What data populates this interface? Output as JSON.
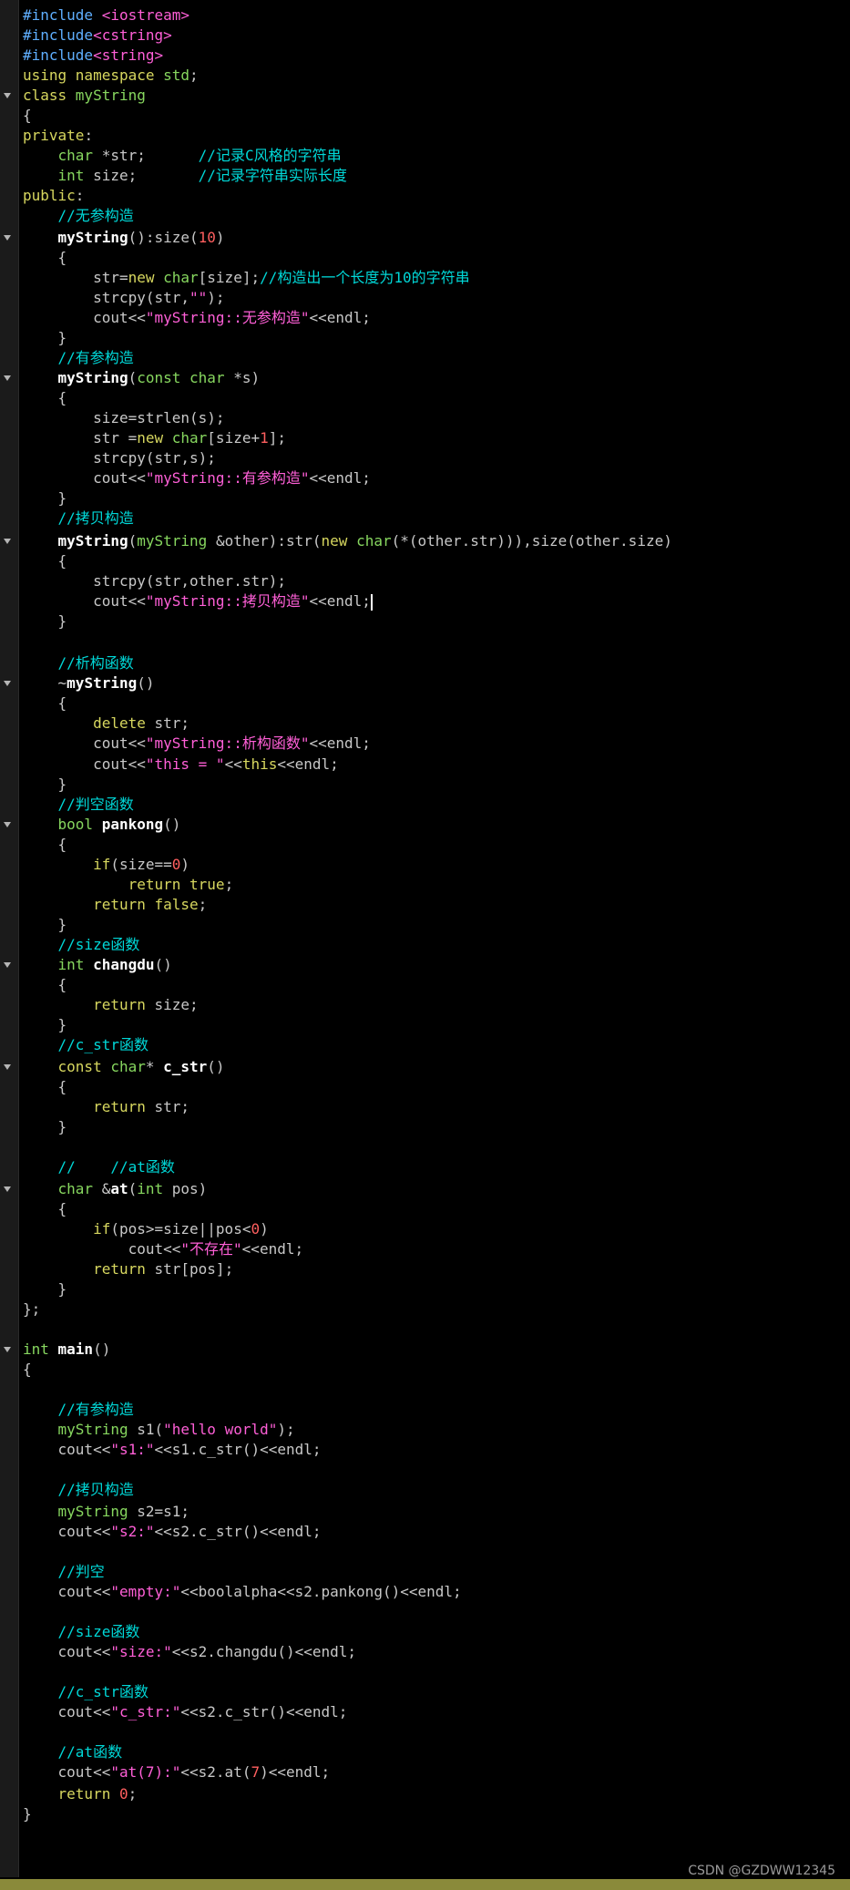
{
  "watermark": "CSDN @GZDWW12345",
  "code_lines": [
    [
      [
        "p",
        "#include "
      ],
      [
        "s",
        "<iostream>"
      ]
    ],
    [
      [
        "p",
        "#include"
      ],
      [
        "s",
        "<cstring>"
      ]
    ],
    [
      [
        "p",
        "#include"
      ],
      [
        "s",
        "<string>"
      ]
    ],
    [
      [
        "k",
        "using namespace "
      ],
      [
        "t",
        "std"
      ],
      [
        "",
        "; "
      ]
    ],
    [
      [
        "k",
        "class "
      ],
      [
        "t",
        "myString"
      ]
    ],
    [
      [
        "",
        "{"
      ]
    ],
    [
      [
        "k",
        "private"
      ],
      [
        "",
        ":"
      ]
    ],
    [
      [
        "",
        "    "
      ],
      [
        "t",
        "char "
      ],
      [
        "",
        "*str;      "
      ],
      [
        "c",
        "//记录C风格的字符串"
      ]
    ],
    [
      [
        "",
        "    "
      ],
      [
        "t",
        "int "
      ],
      [
        "",
        "size;       "
      ],
      [
        "c",
        "//记录字符串实际长度"
      ]
    ],
    [
      [
        "k",
        "public"
      ],
      [
        "",
        ":"
      ]
    ],
    [
      [
        "",
        "    "
      ],
      [
        "c",
        "//无参构造"
      ]
    ],
    [
      [
        "",
        "    "
      ],
      [
        "f",
        "myString"
      ],
      [
        "",
        "():size("
      ],
      [
        "n",
        "10"
      ],
      [
        "",
        ")"
      ]
    ],
    [
      [
        "",
        "    {"
      ]
    ],
    [
      [
        "",
        "        str="
      ],
      [
        "k",
        "new "
      ],
      [
        "t",
        "char"
      ],
      [
        "",
        "[size];"
      ],
      [
        "c",
        "//构造出一个长度为10的字符串"
      ]
    ],
    [
      [
        "",
        "        strcpy(str,"
      ],
      [
        "s",
        "\"\""
      ],
      [
        "",
        ");"
      ]
    ],
    [
      [
        "",
        "        cout<<"
      ],
      [
        "s",
        "\"myString::无参构造\""
      ],
      [
        "",
        "<<endl;"
      ]
    ],
    [
      [
        "",
        "    }"
      ]
    ],
    [
      [
        "",
        "    "
      ],
      [
        "c",
        "//有参构造"
      ]
    ],
    [
      [
        "",
        "    "
      ],
      [
        "f",
        "myString"
      ],
      [
        "",
        "("
      ],
      [
        "t",
        "const char "
      ],
      [
        "",
        "*s)"
      ]
    ],
    [
      [
        "",
        "    {"
      ]
    ],
    [
      [
        "",
        "        size=strlen(s);"
      ]
    ],
    [
      [
        "",
        "        str ="
      ],
      [
        "k",
        "new "
      ],
      [
        "t",
        "char"
      ],
      [
        "",
        "[size+"
      ],
      [
        "n",
        "1"
      ],
      [
        "",
        "];"
      ]
    ],
    [
      [
        "",
        "        strcpy(str,s);"
      ]
    ],
    [
      [
        "",
        "        cout<<"
      ],
      [
        "s",
        "\"myString::有参构造\""
      ],
      [
        "",
        "<<endl;"
      ]
    ],
    [
      [
        "",
        "    }"
      ]
    ],
    [
      [
        "",
        "    "
      ],
      [
        "c",
        "//拷贝构造"
      ]
    ],
    [
      [
        "",
        "    "
      ],
      [
        "f",
        "myString"
      ],
      [
        "",
        "("
      ],
      [
        "t",
        "myString "
      ],
      [
        "",
        "&other):str("
      ],
      [
        "k",
        "new "
      ],
      [
        "t",
        "char"
      ],
      [
        "",
        "(*(other.str))),size(other.size)"
      ]
    ],
    [
      [
        "",
        "    {"
      ]
    ],
    [
      [
        "",
        "        strcpy(str,other.str);"
      ]
    ],
    [
      [
        "",
        "        cout<<"
      ],
      [
        "s",
        "\"myString::拷贝构造\""
      ],
      [
        "",
        "<<endl;"
      ],
      [
        "caret",
        ""
      ]
    ],
    [
      [
        "",
        "    }"
      ]
    ],
    [
      [
        "",
        ""
      ]
    ],
    [
      [
        "",
        "    "
      ],
      [
        "c",
        "//析构函数"
      ]
    ],
    [
      [
        "",
        "    ~"
      ],
      [
        "f",
        "myString"
      ],
      [
        "",
        "()"
      ]
    ],
    [
      [
        "",
        "    {"
      ]
    ],
    [
      [
        "",
        "        "
      ],
      [
        "k",
        "delete "
      ],
      [
        "",
        "str;"
      ]
    ],
    [
      [
        "",
        "        cout<<"
      ],
      [
        "s",
        "\"myString::析构函数\""
      ],
      [
        "",
        "<<endl;"
      ]
    ],
    [
      [
        "",
        "        cout<<"
      ],
      [
        "s",
        "\"this = \""
      ],
      [
        "",
        "<<"
      ],
      [
        "k",
        "this"
      ],
      [
        "",
        "<<endl;"
      ]
    ],
    [
      [
        "",
        "    }"
      ]
    ],
    [
      [
        "",
        "    "
      ],
      [
        "c",
        "//判空函数"
      ]
    ],
    [
      [
        "",
        "    "
      ],
      [
        "t",
        "bool "
      ],
      [
        "f",
        "pankong"
      ],
      [
        "",
        "()"
      ]
    ],
    [
      [
        "",
        "    {"
      ]
    ],
    [
      [
        "",
        "        "
      ],
      [
        "k",
        "if"
      ],
      [
        "",
        "(size=="
      ],
      [
        "n",
        "0"
      ],
      [
        "",
        ")"
      ]
    ],
    [
      [
        "",
        "            "
      ],
      [
        "k",
        "return true"
      ],
      [
        "",
        ";"
      ]
    ],
    [
      [
        "",
        "        "
      ],
      [
        "k",
        "return false"
      ],
      [
        "",
        ";"
      ]
    ],
    [
      [
        "",
        "    }"
      ]
    ],
    [
      [
        "",
        "    "
      ],
      [
        "c",
        "//size函数"
      ]
    ],
    [
      [
        "",
        "    "
      ],
      [
        "t",
        "int "
      ],
      [
        "f",
        "changdu"
      ],
      [
        "",
        "()"
      ]
    ],
    [
      [
        "",
        "    {"
      ]
    ],
    [
      [
        "",
        "        "
      ],
      [
        "k",
        "return "
      ],
      [
        "",
        "size;"
      ]
    ],
    [
      [
        "",
        "    }"
      ]
    ],
    [
      [
        "",
        "    "
      ],
      [
        "c",
        "//c_str函数"
      ]
    ],
    [
      [
        "",
        "    "
      ],
      [
        "k",
        "const "
      ],
      [
        "t",
        "char"
      ],
      [
        "",
        "* "
      ],
      [
        "f",
        "c_str"
      ],
      [
        "",
        "()"
      ]
    ],
    [
      [
        "",
        "    {"
      ]
    ],
    [
      [
        "",
        "        "
      ],
      [
        "k",
        "return "
      ],
      [
        "",
        "str;"
      ]
    ],
    [
      [
        "",
        "    }"
      ]
    ],
    [
      [
        "",
        ""
      ]
    ],
    [
      [
        "",
        "    "
      ],
      [
        "c",
        "//    //at函数"
      ]
    ],
    [
      [
        "",
        "    "
      ],
      [
        "t",
        "char "
      ],
      [
        "",
        "&"
      ],
      [
        "f",
        "at"
      ],
      [
        "",
        "("
      ],
      [
        "t",
        "int "
      ],
      [
        "",
        "pos)"
      ]
    ],
    [
      [
        "",
        "    {"
      ]
    ],
    [
      [
        "",
        "        "
      ],
      [
        "k",
        "if"
      ],
      [
        "",
        "(pos>=size||pos<"
      ],
      [
        "n",
        "0"
      ],
      [
        "",
        ")"
      ]
    ],
    [
      [
        "",
        "            cout<<"
      ],
      [
        "s",
        "\"不存在\""
      ],
      [
        "",
        "<<endl;"
      ]
    ],
    [
      [
        "",
        "        "
      ],
      [
        "k",
        "return "
      ],
      [
        "",
        "str[pos];"
      ]
    ],
    [
      [
        "",
        "    }"
      ]
    ],
    [
      [
        "",
        "};"
      ]
    ],
    [
      [
        "",
        ""
      ]
    ],
    [
      [
        "t",
        "int "
      ],
      [
        "f",
        "main"
      ],
      [
        "",
        "()"
      ]
    ],
    [
      [
        "",
        "{"
      ]
    ],
    [
      [
        "",
        ""
      ]
    ],
    [
      [
        "",
        "    "
      ],
      [
        "c",
        "//有参构造"
      ]
    ],
    [
      [
        "",
        "    "
      ],
      [
        "t",
        "myString "
      ],
      [
        "",
        "s1("
      ],
      [
        "s",
        "\"hello world\""
      ],
      [
        "",
        ");"
      ]
    ],
    [
      [
        "",
        "    cout<<"
      ],
      [
        "s",
        "\"s1:\""
      ],
      [
        "",
        "<<s1.c_str()<<endl;"
      ]
    ],
    [
      [
        "",
        ""
      ]
    ],
    [
      [
        "",
        "    "
      ],
      [
        "c",
        "//拷贝构造"
      ]
    ],
    [
      [
        "",
        "    "
      ],
      [
        "t",
        "myString "
      ],
      [
        "",
        "s2=s1;"
      ]
    ],
    [
      [
        "",
        "    cout<<"
      ],
      [
        "s",
        "\"s2:\""
      ],
      [
        "",
        "<<s2.c_str()<<endl;"
      ]
    ],
    [
      [
        "",
        ""
      ]
    ],
    [
      [
        "",
        "    "
      ],
      [
        "c",
        "//判空"
      ]
    ],
    [
      [
        "",
        "    cout<<"
      ],
      [
        "s",
        "\"empty:\""
      ],
      [
        "",
        "<<boolalpha<<s2.pankong()<<endl;"
      ]
    ],
    [
      [
        "",
        ""
      ]
    ],
    [
      [
        "",
        "    "
      ],
      [
        "c",
        "//size函数"
      ]
    ],
    [
      [
        "",
        "    cout<<"
      ],
      [
        "s",
        "\"size:\""
      ],
      [
        "",
        "<<s2.changdu()<<endl;"
      ]
    ],
    [
      [
        "",
        ""
      ]
    ],
    [
      [
        "",
        "    "
      ],
      [
        "c",
        "//c_str函数"
      ]
    ],
    [
      [
        "",
        "    cout<<"
      ],
      [
        "s",
        "\"c_str:\""
      ],
      [
        "",
        "<<s2.c_str()<<endl;"
      ]
    ],
    [
      [
        "",
        ""
      ]
    ],
    [
      [
        "",
        "    "
      ],
      [
        "c",
        "//at函数"
      ]
    ],
    [
      [
        "",
        "    cout<<"
      ],
      [
        "s",
        "\"at(7):\""
      ],
      [
        "",
        "<<s2.at("
      ],
      [
        "n",
        "7"
      ],
      [
        "",
        ")<<endl;"
      ]
    ],
    [
      [
        "",
        "    "
      ],
      [
        "k",
        "return "
      ],
      [
        "n",
        "0"
      ],
      [
        "",
        ";"
      ]
    ],
    [
      [
        "",
        "}"
      ]
    ]
  ]
}
